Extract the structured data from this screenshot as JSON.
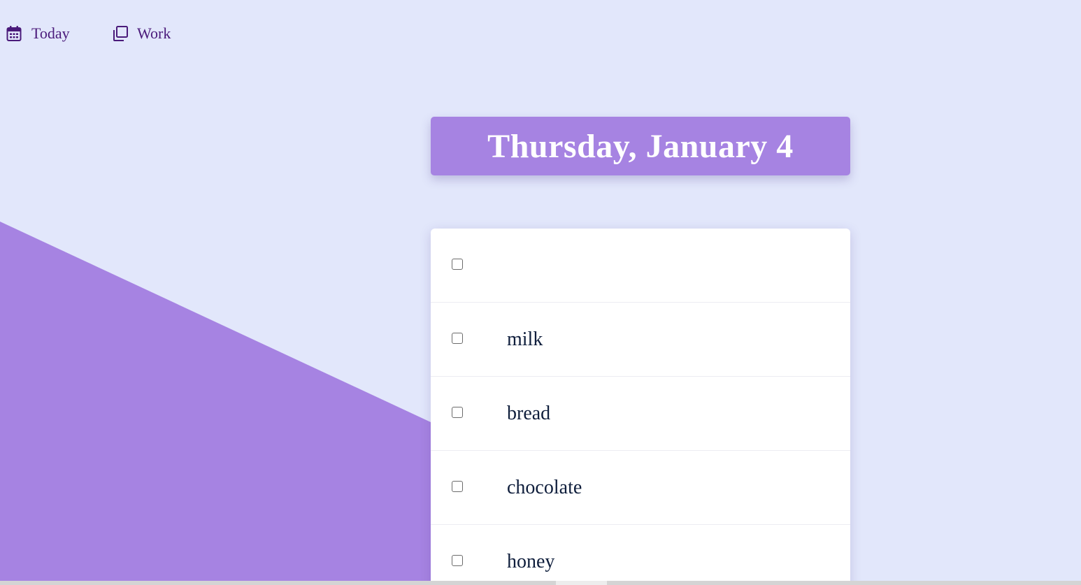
{
  "nav": {
    "today_label": "Today",
    "work_label": "Work",
    "today_icon": "calendar-icon",
    "work_icon": "copy-icon"
  },
  "header": {
    "date": "Thursday, January 4"
  },
  "todo": {
    "new_item_placeholder": "",
    "items": [
      {
        "text": "milk",
        "checked": false
      },
      {
        "text": "bread",
        "checked": false
      },
      {
        "text": "chocolate",
        "checked": false
      },
      {
        "text": "honey",
        "checked": false
      }
    ]
  },
  "colors": {
    "background": "#e2e7fb",
    "accent": "#a683e2",
    "nav_text": "#4a1a7a",
    "item_text": "#0f1e3c"
  }
}
